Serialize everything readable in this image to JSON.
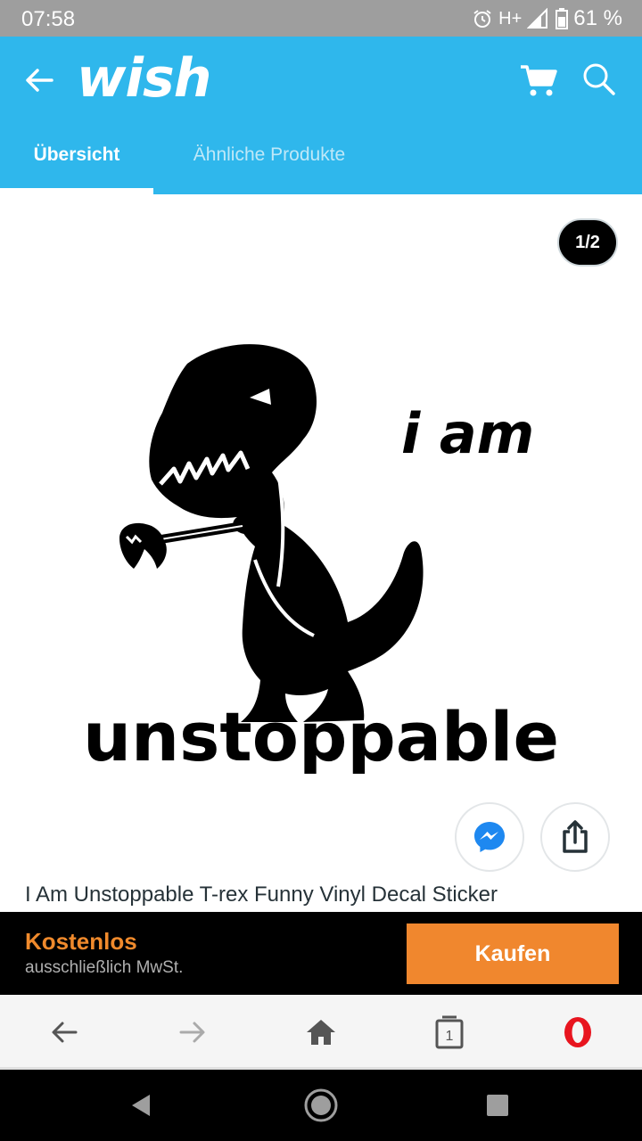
{
  "status_bar": {
    "time": "07:58",
    "network": "H+",
    "battery": "61 %",
    "icons": [
      "alarm-icon",
      "signal-icon",
      "battery-icon"
    ]
  },
  "app_bar": {
    "logo": "wish",
    "background_color": "#2fb7ec",
    "icons": [
      "back-arrow-icon",
      "cart-icon",
      "search-icon"
    ]
  },
  "tabs": [
    {
      "label": "Übersicht",
      "selected": true
    },
    {
      "label": "Ähnliche Produkte",
      "selected": false
    }
  ],
  "gallery": {
    "counter": "1/2",
    "artwork_text": [
      "i am",
      "unstoppable"
    ]
  },
  "share_buttons": [
    "messenger-icon",
    "share-icon"
  ],
  "product": {
    "title": "I Am Unstoppable T-rex Funny Vinyl Decal Sticker"
  },
  "buy_bar": {
    "price": "Kostenlos",
    "tax_note": "ausschließlich MwSt.",
    "buy_label": "Kaufen",
    "accent_color": "#f0872e"
  },
  "browser_bar": {
    "tab_count": "1",
    "icons": [
      "back-icon",
      "forward-icon",
      "home-icon",
      "tabs-icon",
      "opera-icon"
    ]
  },
  "system_nav": {
    "icons": [
      "back-triangle-icon",
      "home-circle-icon",
      "recents-square-icon"
    ]
  }
}
